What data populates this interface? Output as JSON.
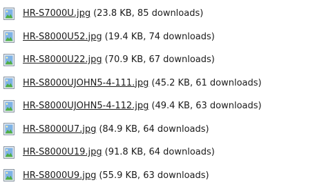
{
  "attachments": [
    {
      "filename": "HR-S7000U.jpg",
      "meta": "(23.8 KB, 85 downloads)"
    },
    {
      "filename": "HR-S8000U52.jpg",
      "meta": "(19.4 KB, 74 downloads)"
    },
    {
      "filename": "HR-S8000U22.jpg",
      "meta": "(70.9 KB, 67 downloads)"
    },
    {
      "filename": "HR-S8000UJOHN5-4-111.jpg",
      "meta": "(45.2 KB, 61 downloads)"
    },
    {
      "filename": "HR-S8000UJOHN5-4-112.jpg",
      "meta": "(49.4 KB, 63 downloads)"
    },
    {
      "filename": "HR-S8000U7.jpg",
      "meta": "(84.9 KB, 64 downloads)"
    },
    {
      "filename": "HR-S8000U19.jpg",
      "meta": "(91.8 KB, 64 downloads)"
    },
    {
      "filename": "HR-S8000U9.jpg",
      "meta": "(55.9 KB, 63 downloads)"
    }
  ],
  "icon": "image-file-icon",
  "colors": {
    "text": "#1a1a1a",
    "icon_frame": "#8a96a3",
    "icon_sky": "#7fb3e6",
    "icon_ground": "#4fae45"
  }
}
